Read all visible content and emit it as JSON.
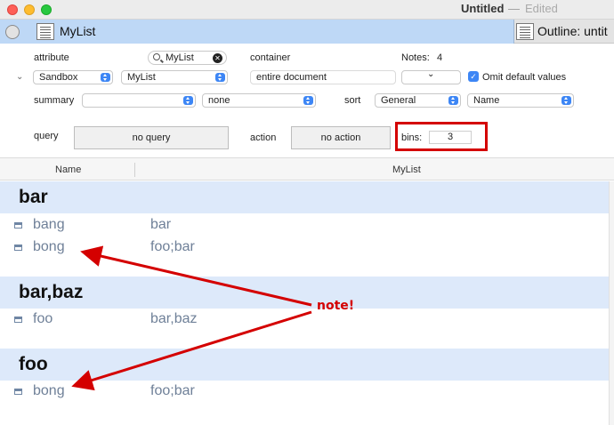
{
  "window": {
    "title": "Untitled",
    "separator": "—",
    "status": "Edited"
  },
  "tabs": [
    {
      "label": "MyList",
      "active": true
    },
    {
      "label": "Outline: untit",
      "active": false
    }
  ],
  "controls": {
    "attribute_label": "attribute",
    "search_value": "MyList",
    "container_label": "container",
    "notes_label": "Notes:",
    "notes_count": "4",
    "attribute_group_popup": "Sandbox",
    "attribute_popup": "MyList",
    "container_popup": "entire document",
    "extra_popup": "",
    "omit_default_label": "Omit default values",
    "omit_default_checked": true,
    "summary_label": "summary",
    "summary_popup": "",
    "summary_value_popup": "none",
    "sort_label": "sort",
    "sort_group_popup": "General",
    "sort_popup": "Name",
    "query_label": "query",
    "query_button": "no query",
    "action_label": "action",
    "action_button": "no action",
    "bins_label": "bins:",
    "bins_value": "3"
  },
  "columns": {
    "name": "Name",
    "value": "MyList"
  },
  "bins": [
    {
      "title": "bar",
      "rows": [
        {
          "name": "bang",
          "value": "bar"
        },
        {
          "name": "bong",
          "value": "foo;bar"
        }
      ]
    },
    {
      "title": "bar,baz",
      "rows": [
        {
          "name": "foo",
          "value": "bar,baz"
        }
      ]
    },
    {
      "title": "foo",
      "rows": [
        {
          "name": "bong",
          "value": "foo;bar"
        }
      ]
    }
  ],
  "annotation": {
    "text": "note!",
    "color": "#d40000"
  },
  "colors": {
    "accent": "#3d86f5",
    "tab_active": "#bed8f6",
    "bin_header": "#dde9fa",
    "row_text": "#6f8098"
  }
}
